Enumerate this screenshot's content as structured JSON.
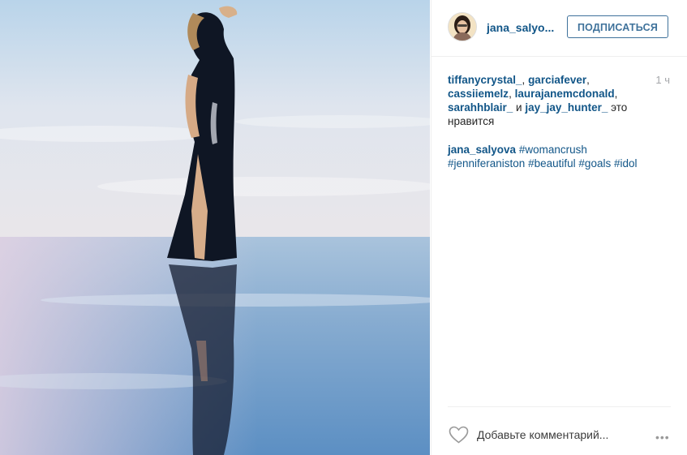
{
  "post": {
    "username": "jana_salyo...",
    "follow_label": "ПОДПИСАТЬСЯ",
    "time": "1 ч",
    "likes": {
      "users": [
        "tiffanycrystal_",
        "garciafever",
        "cassiiemelz",
        "laurajanemcdonald",
        "sarahhblair_",
        "jay_jay_hunter_"
      ],
      "sep1": ", ",
      "and_word": " и ",
      "suffix": " это нравится"
    },
    "caption": {
      "author": "jana_salyova",
      "tags": [
        "#womancrush",
        "#jenniferaniston",
        "#beautiful",
        "#goals",
        "#idol"
      ]
    },
    "comment_placeholder": "Добавьте комментарий...",
    "more_label": "•••"
  },
  "colors": {
    "link": "#125688",
    "follow": "#3f729b",
    "muted": "#a5a7aa"
  },
  "icons": {
    "like": "heart-icon",
    "more": "more-options-icon"
  }
}
